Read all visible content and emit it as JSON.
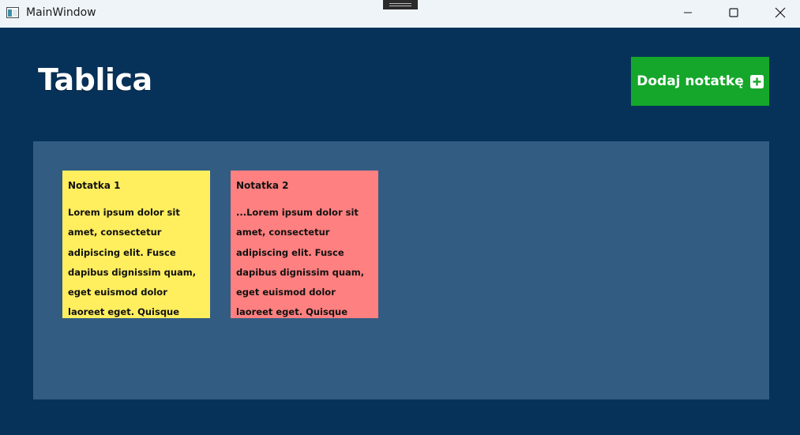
{
  "window": {
    "title": "MainWindow",
    "controls": [
      "minimize-icon",
      "maximize-icon",
      "close-icon"
    ]
  },
  "header": {
    "title": "Tablica",
    "add_button_label": "Dodaj notatkę",
    "add_button_icon": "plus-square-icon"
  },
  "colors": {
    "background": "#06325a",
    "board": "#335c82",
    "add_button": "#15a72b",
    "note_yellow": "#ffee5e",
    "note_red": "#ff8080"
  },
  "notes": [
    {
      "title": "Notatka 1",
      "body": "Lorem ipsum dolor sit amet, consectetur adipiscing elit. Fusce dapibus dignissim quam, eget euismod dolor laoreet eget. Quisque molestie justo lorem, a",
      "color": "#ffee5e"
    },
    {
      "title": "Notatka 2",
      "body": "...Lorem ipsum dolor sit amet, consectetur adipiscing elit. Fusce dapibus dignissim quam, eget euismod dolor laoreet eget. Quisque molestie justo lorem, a",
      "color": "#ff8080"
    }
  ]
}
